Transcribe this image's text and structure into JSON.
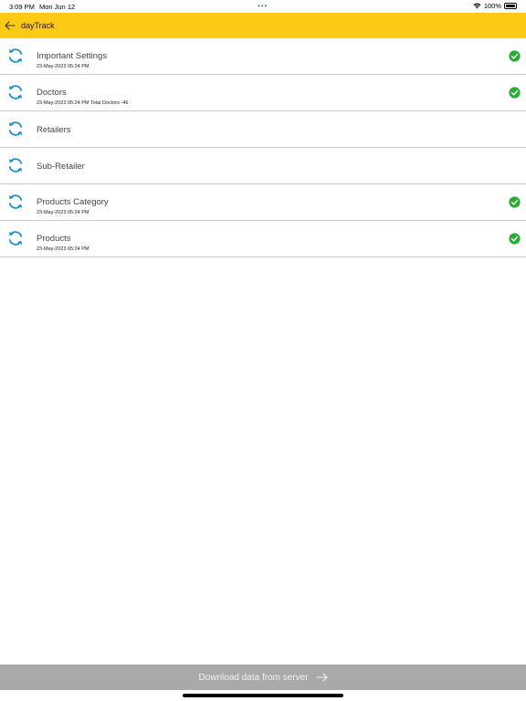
{
  "status_bar": {
    "time": "3:09 PM",
    "date": "Mon Jun 12",
    "battery": "100%",
    "icons": [
      "wifi-icon",
      "battery-icon"
    ]
  },
  "app_bar": {
    "title": "dayTrack",
    "back_icon": "back-arrow-icon",
    "color": "#fcc914"
  },
  "sync_items": [
    {
      "label": "Important Settings",
      "sub": "23-May-2023 05:24 PM",
      "synced": true
    },
    {
      "label": "Doctors",
      "sub": "23-May-2023 05:24 PM Total Doctors -46",
      "synced": true
    },
    {
      "label": "Retailers",
      "sub": "",
      "synced": false
    },
    {
      "label": "Sub-Retailer",
      "sub": "",
      "synced": false
    },
    {
      "label": "Products Category",
      "sub": "23-May-2023 05:24 PM",
      "synced": true
    },
    {
      "label": "Products",
      "sub": "23-May-2023 05:24 PM",
      "synced": true
    }
  ],
  "colors": {
    "sync_icon": "#1f8fd6",
    "check": "#2eaa3a",
    "button_bg": "#a9a9a9"
  },
  "download_button": {
    "label": "Download data from server",
    "icon": "arrow-right-icon"
  }
}
